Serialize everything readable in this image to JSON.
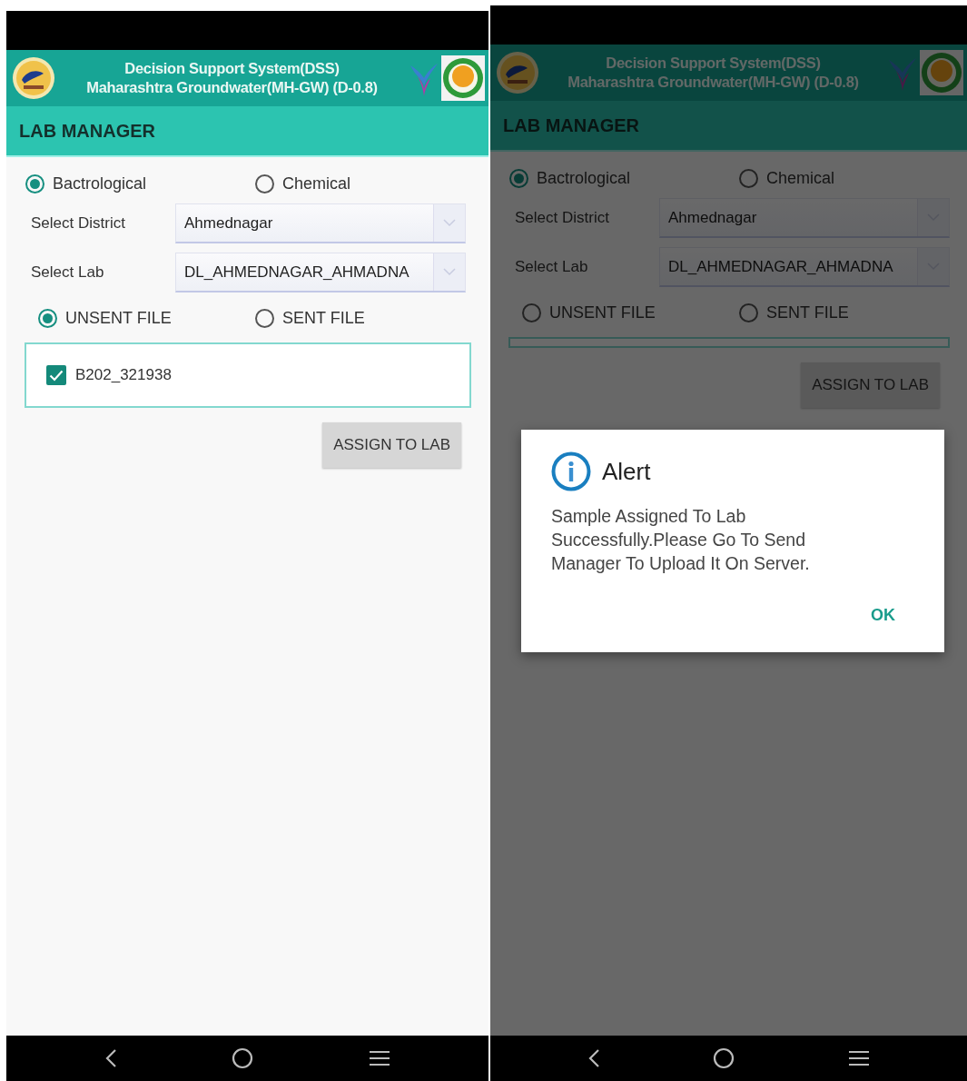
{
  "screens": [
    {
      "app_title": "Decision Support System(DSS)",
      "app_subtitle": "Maharashtra Groundwater(MH-GW) (D-0.8)",
      "page_title": "LAB MANAGER",
      "test_types": [
        {
          "label": "Bactrological",
          "selected": true
        },
        {
          "label": "Chemical",
          "selected": false
        }
      ],
      "fields": [
        {
          "label": "Select District",
          "value": "Ahmednagar"
        },
        {
          "label": "Select Lab",
          "value": "DL_AHMEDNAGAR_AHMADNA"
        }
      ],
      "file_types": [
        {
          "label": "UNSENT FILE",
          "selected": true
        },
        {
          "label": "SENT FILE",
          "selected": false
        }
      ],
      "files": [
        {
          "label": "B202_321938",
          "checked": true
        }
      ],
      "button": "ASSIGN TO LAB"
    },
    {
      "app_title": "Decision Support System(DSS)",
      "app_subtitle": "Maharashtra Groundwater(MH-GW) (D-0.8)",
      "page_title": "LAB MANAGER",
      "test_types": [
        {
          "label": "Bactrological",
          "selected": true
        },
        {
          "label": "Chemical",
          "selected": false
        }
      ],
      "fields": [
        {
          "label": "Select District",
          "value": "Ahmednagar"
        },
        {
          "label": "Select Lab",
          "value": "DL_AHMEDNAGAR_AHMADNA"
        }
      ],
      "file_types": [
        {
          "label": "UNSENT FILE",
          "selected": false
        },
        {
          "label": "SENT FILE",
          "selected": false
        }
      ],
      "button": "ASSIGN TO LAB",
      "dialog": {
        "title": "Alert",
        "message": "Sample Assigned To Lab Successfully.Please Go To Send Manager To Upload It On Server.",
        "button": "OK"
      }
    }
  ]
}
